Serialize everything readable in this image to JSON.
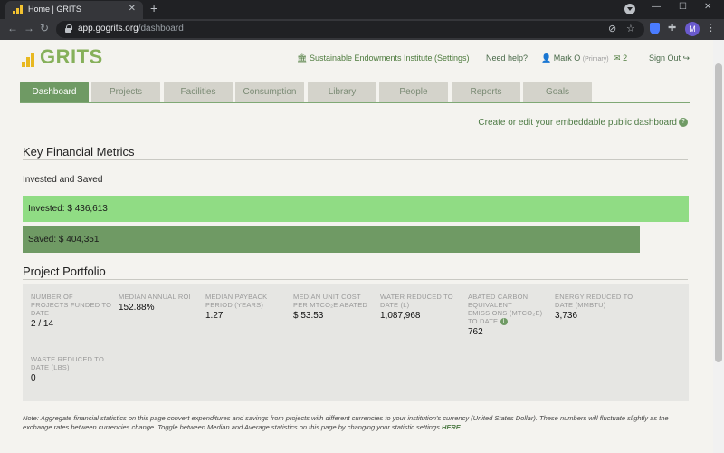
{
  "browser": {
    "tab_title": "Home | GRITS",
    "url_host": "app.gogrits.org",
    "url_path": "/dashboard",
    "profile_initial": "M"
  },
  "header": {
    "logo_text": "GRITS",
    "institution": "Sustainable Endowments Institute (Settings)",
    "help": "Need help?",
    "user_name": "Mark O",
    "user_role": "(Primary)",
    "message_count": "2",
    "sign_out": "Sign Out"
  },
  "nav": {
    "tabs": [
      {
        "label": "Dashboard"
      },
      {
        "label": "Projects"
      },
      {
        "label": "Facilities"
      },
      {
        "label": "Consumption"
      },
      {
        "label": "Library"
      },
      {
        "label": "People"
      },
      {
        "label": "Reports"
      },
      {
        "label": "Goals"
      }
    ]
  },
  "embed_link": "Create or edit your embeddable public dashboard",
  "financial": {
    "title": "Key Financial Metrics",
    "subtitle": "Invested and Saved",
    "invested_label": "Invested: $ 436,613",
    "saved_label": "Saved: $ 404,351",
    "invested_value": 436613,
    "saved_value": 404351
  },
  "portfolio": {
    "title": "Project Portfolio",
    "metrics": [
      {
        "label": "NUMBER OF PROJECTS FUNDED TO DATE",
        "value": "2 / 14"
      },
      {
        "label": "MEDIAN ANNUAL ROI",
        "value": "152.88%"
      },
      {
        "label": "MEDIAN PAYBACK PERIOD (YEARS)",
        "value": "1.27"
      },
      {
        "label": "MEDIAN UNIT COST PER MTCO₂E ABATED",
        "value": "$ 53.53"
      },
      {
        "label": "WATER REDUCED TO DATE (L)",
        "value": "1,087,968"
      },
      {
        "label": "ABATED CARBON EQUIVALENT EMISSIONS (MTCO₂E) TO DATE",
        "value": "762"
      },
      {
        "label": "ENERGY REDUCED TO DATE (MMBTU)",
        "value": "3,736"
      },
      {
        "label": "WASTE REDUCED TO DATE (LBS)",
        "value": "0"
      }
    ]
  },
  "note": {
    "text": "Note: Aggregate financial statistics on this page convert expenditures and savings from projects with different currencies to your institution's currency (United States Dollar). These numbers will fluctuate slightly as the exchange rates between currencies change. Toggle between Median and Average statistics on this page by changing your statistic settings ",
    "link": "HERE"
  }
}
